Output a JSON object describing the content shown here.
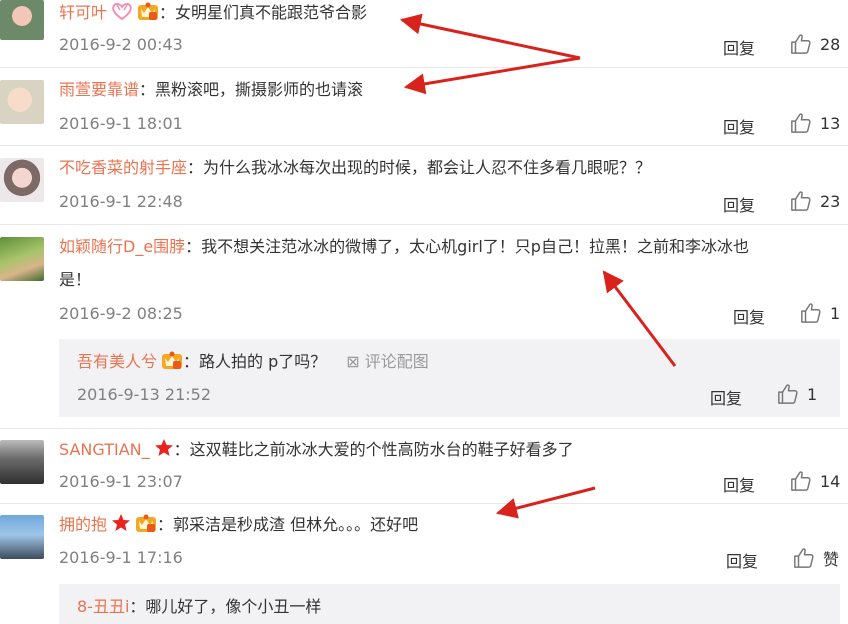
{
  "colors": {
    "author": "#eb7350",
    "meta": "#808080",
    "arrow": "#d9221c",
    "subBg": "#f2f2f5"
  },
  "comments": [
    {
      "author": "轩可叶",
      "badges": [
        "heart-icon",
        "vip-crown-icon"
      ],
      "text": "：女明星们真不能跟范爷合影",
      "time": "2016-9-2 00:43",
      "reply": "回复",
      "likes": "28"
    },
    {
      "author": "雨萱要靠谱",
      "badges": [],
      "text": "：黑粉滚吧，撕摄影师的也请滚",
      "time": "2016-9-1 18:01",
      "reply": "回复",
      "likes": "13"
    },
    {
      "author": "不吃香菜的射手座",
      "badges": [],
      "text": "：为什么我冰冰每次出现的时候，都会让人忍不住多看几眼呢？？",
      "time": "2016-9-1 22:48",
      "reply": "回复",
      "likes": "23"
    },
    {
      "author": "如颖随行D_e围脖",
      "badges": [],
      "text": "：我不想关注范冰冰的微博了，太心机girl了！只p自己！拉黑！之前和李冰冰也",
      "text2": "是！",
      "time": "2016-9-2 08:25",
      "reply": "回复",
      "likes": "1",
      "sub": {
        "author": "吾有美人兮",
        "badges": [
          "vip-crown-icon"
        ],
        "text": "：路人拍的 p了吗？",
        "pic_link": "评论配图",
        "time": "2016-9-13 21:52",
        "reply": "回复",
        "likes": "1"
      }
    },
    {
      "author": "SANGTIAN_",
      "badges": [
        "star-icon"
      ],
      "text": "：这双鞋比之前冰冰大爱的个性高防水台的鞋子好看多了",
      "time": "2016-9-1 23:07",
      "reply": "回复",
      "likes": "14"
    },
    {
      "author": "拥的抱",
      "badges": [
        "star-icon",
        "vip-crown-icon"
      ],
      "text": "：郭采洁是秒成渣 但林允。。。还好吧",
      "time": "2016-9-1 17:16",
      "reply": "回复",
      "likes": "赞",
      "sub": {
        "author": "8-丑丑i",
        "text": "：哪儿好了，像个小丑一样"
      }
    }
  ]
}
